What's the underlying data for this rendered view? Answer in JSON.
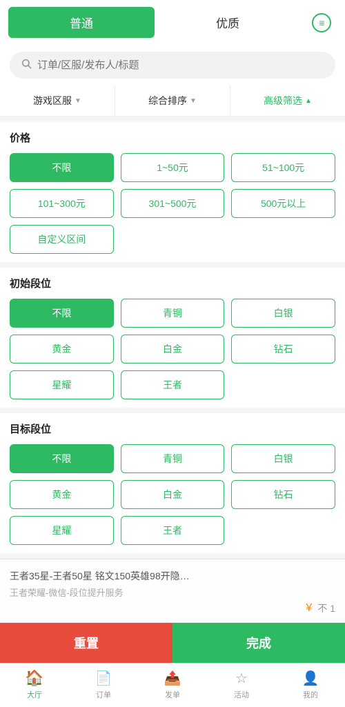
{
  "tabs": {
    "normal_label": "普通",
    "quality_label": "优质",
    "normal_active": true
  },
  "menu_icon": "☰",
  "search": {
    "placeholder": "订单/区服/发布人/标题"
  },
  "filters": {
    "region_label": "游戏区服",
    "sort_label": "综合排序",
    "advanced_label": "高级筛选"
  },
  "price_section": {
    "title": "价格",
    "buttons": [
      {
        "label": "不限",
        "active": true
      },
      {
        "label": "1~50元",
        "active": false
      },
      {
        "label": "51~100元",
        "active": false
      },
      {
        "label": "101~300元",
        "active": false
      },
      {
        "label": "301~500元",
        "active": false
      },
      {
        "label": "500元以上",
        "active": false
      },
      {
        "label": "自定义区间",
        "active": false
      }
    ]
  },
  "initial_rank_section": {
    "title": "初始段位",
    "buttons": [
      {
        "label": "不限",
        "active": true
      },
      {
        "label": "青铜",
        "active": false
      },
      {
        "label": "白银",
        "active": false
      },
      {
        "label": "黄金",
        "active": false
      },
      {
        "label": "白金",
        "active": false
      },
      {
        "label": "钻石",
        "active": false
      },
      {
        "label": "星耀",
        "active": false
      },
      {
        "label": "王者",
        "active": false
      }
    ]
  },
  "target_rank_section": {
    "title": "目标段位",
    "buttons": [
      {
        "label": "不限",
        "active": true
      },
      {
        "label": "青铜",
        "active": false
      },
      {
        "label": "白银",
        "active": false
      },
      {
        "label": "黄金",
        "active": false
      },
      {
        "label": "白金",
        "active": false
      },
      {
        "label": "钻石",
        "active": false
      },
      {
        "label": "星耀",
        "active": false
      },
      {
        "label": "王者",
        "active": false
      }
    ]
  },
  "overlay": {
    "main_text": "王者35星-王者50星 铭文150英雄98开隐…",
    "sub_text": "王者荣耀-微信-段位提升服务",
    "price_symbol": "¥",
    "price_text": "不 1"
  },
  "actions": {
    "reset_label": "重置",
    "done_label": "完成"
  },
  "bottom_nav": {
    "items": [
      {
        "label": "大厅",
        "icon": "🏠",
        "active": true
      },
      {
        "label": "订单",
        "icon": "📄",
        "active": false
      },
      {
        "label": "发单",
        "icon": "📤",
        "active": false
      },
      {
        "label": "活动",
        "icon": "⭐",
        "active": false
      },
      {
        "label": "我的",
        "icon": "👤",
        "active": false
      }
    ]
  }
}
